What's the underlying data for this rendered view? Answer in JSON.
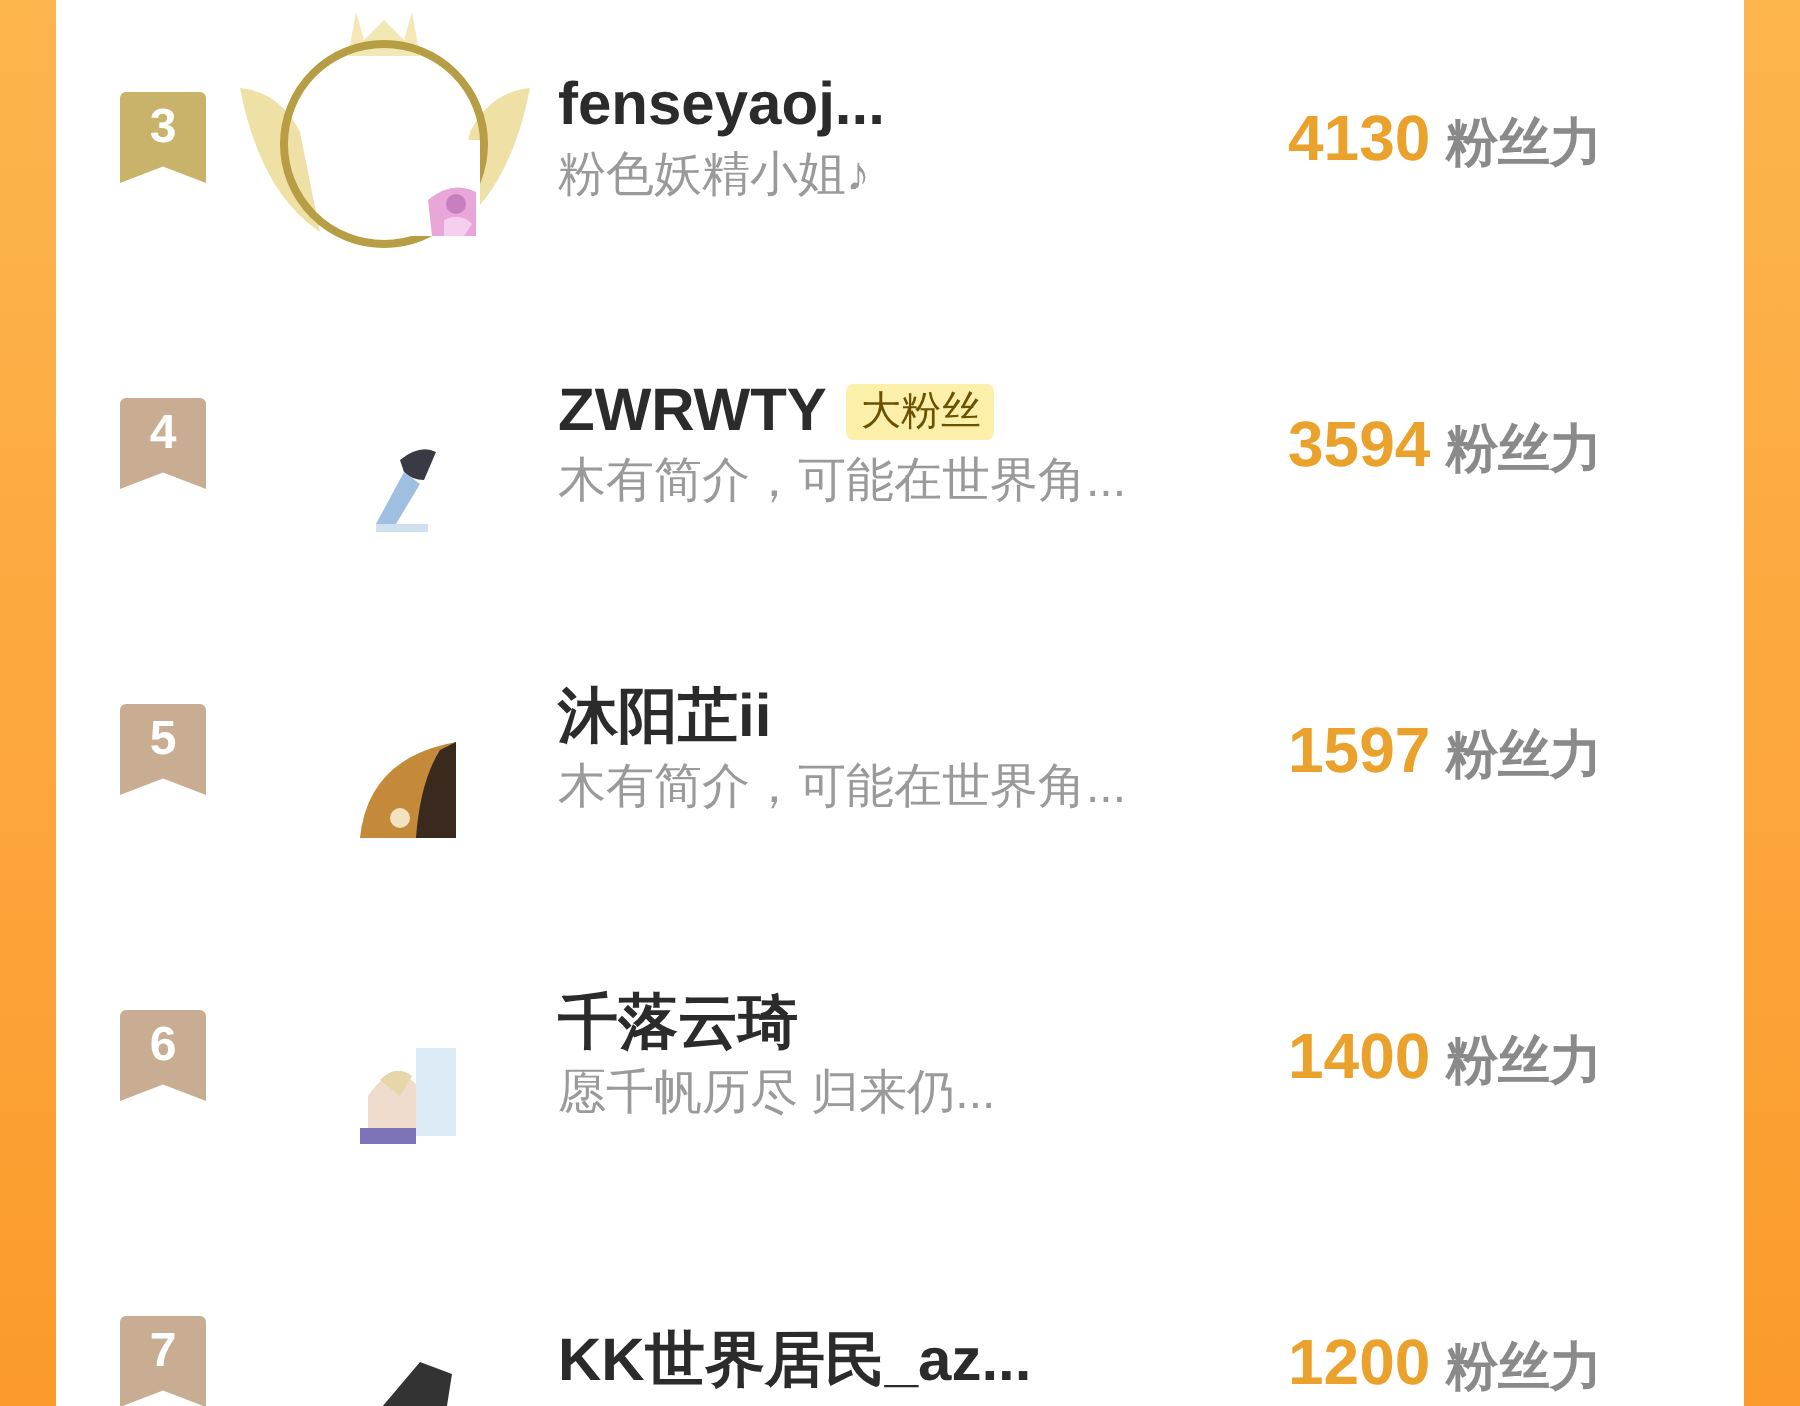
{
  "ranking": [
    {
      "rank": "3",
      "kind": "crowned",
      "name": "fenseyaoj...",
      "bio": "粉色妖精小姐♪",
      "score": "4130",
      "unit": "粉丝力"
    },
    {
      "rank": "4",
      "kind": "plain",
      "name": "ZWRWTY",
      "badge": "大粉丝",
      "bio": "木有简介，可能在世界角...",
      "score": "3594",
      "unit": "粉丝力"
    },
    {
      "rank": "5",
      "kind": "plain",
      "name": "沐阳芷ii",
      "bio": "木有简介，可能在世界角...",
      "score": "1597",
      "unit": "粉丝力"
    },
    {
      "rank": "6",
      "kind": "plain",
      "name": "千落云琦",
      "bio": "愿千帆历尽 归来仍...",
      "score": "1400",
      "unit": "粉丝力"
    },
    {
      "rank": "7",
      "kind": "plain",
      "name": "KK世界居民_az...",
      "score": "1200",
      "unit": "粉丝力"
    }
  ]
}
